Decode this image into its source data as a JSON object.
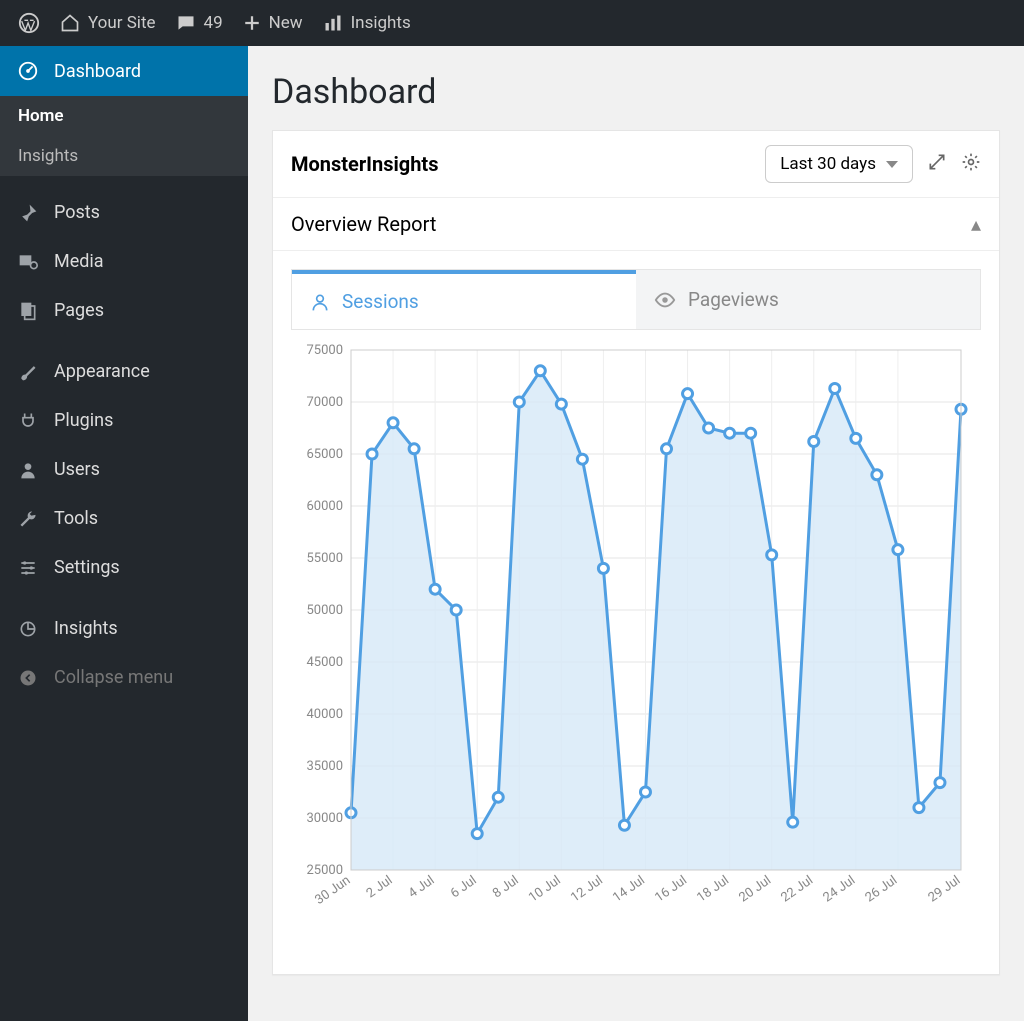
{
  "adminbar": {
    "site_name": "Your Site",
    "comment_count": "49",
    "new_label": "New",
    "insights_label": "Insights"
  },
  "sidebar": {
    "dashboard": "Dashboard",
    "sub_home": "Home",
    "sub_insights": "Insights",
    "posts": "Posts",
    "media": "Media",
    "pages": "Pages",
    "appearance": "Appearance",
    "plugins": "Plugins",
    "users": "Users",
    "tools": "Tools",
    "settings": "Settings",
    "insights2": "Insights",
    "collapse": "Collapse menu"
  },
  "page": {
    "title": "Dashboard"
  },
  "widget": {
    "title": "MonsterInsights",
    "range": "Last 30 days",
    "report_title": "Overview Report",
    "tab_sessions": "Sessions",
    "tab_pageviews": "Pageviews"
  },
  "chart_data": {
    "type": "line",
    "title": "Sessions",
    "xlabel": "",
    "ylabel": "",
    "ylim": [
      25000,
      75000
    ],
    "yticks": [
      25000,
      30000,
      35000,
      40000,
      45000,
      50000,
      55000,
      60000,
      65000,
      70000,
      75000
    ],
    "xticks": [
      "30 Jun",
      "2 Jul",
      "4 Jul",
      "6 Jul",
      "8 Jul",
      "10 Jul",
      "12 Jul",
      "14 Jul",
      "16 Jul",
      "18 Jul",
      "20 Jul",
      "22 Jul",
      "24 Jul",
      "26 Jul",
      "29 Jul"
    ],
    "categories": [
      "30 Jun",
      "1 Jul",
      "2 Jul",
      "3 Jul",
      "4 Jul",
      "5 Jul",
      "6 Jul",
      "7 Jul",
      "8 Jul",
      "9 Jul",
      "10 Jul",
      "11 Jul",
      "12 Jul",
      "13 Jul",
      "14 Jul",
      "15 Jul",
      "16 Jul",
      "17 Jul",
      "18 Jul",
      "19 Jul",
      "20 Jul",
      "21 Jul",
      "22 Jul",
      "23 Jul",
      "24 Jul",
      "25 Jul",
      "26 Jul",
      "27 Jul",
      "28 Jul",
      "29 Jul"
    ],
    "values": [
      30500,
      65000,
      68000,
      65500,
      52000,
      50000,
      28500,
      32000,
      70000,
      73000,
      69800,
      64500,
      54000,
      29300,
      32500,
      65500,
      70800,
      67500,
      67000,
      67000,
      55300,
      29600,
      66200,
      71300,
      66500,
      63000,
      55800,
      31000,
      33400,
      69300
    ]
  }
}
